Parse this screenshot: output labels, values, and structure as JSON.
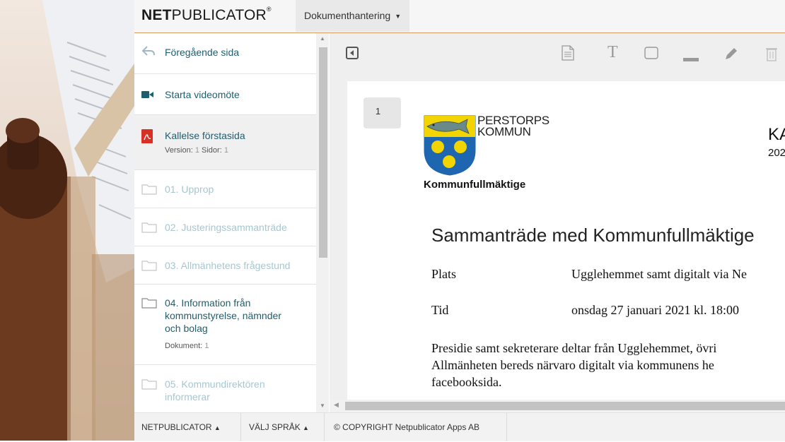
{
  "header": {
    "logo_bold": "NET",
    "logo_rest": "PUBLICATOR",
    "logo_reg": "®",
    "dropdown_label": "Dokumenthantering"
  },
  "sidebar": {
    "items": [
      {
        "label": "Föregående sida",
        "icon": "back-arrow-icon"
      },
      {
        "label": "Starta videomöte",
        "icon": "video-camera-icon"
      },
      {
        "label": "Kallelse förstasida",
        "icon": "pdf-icon",
        "version_label": "Version:",
        "version": "1",
        "pages_label": "Sidor:",
        "pages": "1"
      },
      {
        "label": "01. Upprop",
        "icon": "folder-icon"
      },
      {
        "label": "02. Justeringssammanträde",
        "icon": "folder-icon"
      },
      {
        "label": "03. Allmänhetens frågestund",
        "icon": "folder-icon"
      },
      {
        "label_lines": [
          "04. Information från",
          "kommunstyrelse, nämnder",
          "och bolag"
        ],
        "icon": "folder-icon",
        "docs_label": "Dokument:",
        "docs": "1"
      },
      {
        "label_lines": [
          "05. Kommundirektören",
          "informerar"
        ],
        "icon": "folder-icon"
      }
    ]
  },
  "toolbar": {
    "icons": [
      "collapse-panel-icon",
      "document-icon",
      "text-icon",
      "rectangle-icon",
      "line-icon",
      "pen-icon",
      "trash-icon"
    ]
  },
  "document": {
    "page_number": "1",
    "org_line1": "PERSTORPS",
    "org_line2": "KOMMUN",
    "org_unit": "Kommunfullmäktige",
    "header_right1": "KA",
    "header_right2": "202",
    "title": "Sammanträde med Kommunfullmäktige",
    "rows": [
      {
        "label": "Plats",
        "value": "Ugglehemmet samt digitalt via Ne"
      },
      {
        "label": "Tid",
        "value": "onsdag 27 januari 2021 kl. 18:00"
      }
    ],
    "paragraph_lines": [
      "Presidie samt sekreterare deltar från Ugglehemmet, övri",
      "Allmänheten bereds närvaro digitalt via kommunens he",
      "facebooksida."
    ]
  },
  "footer": {
    "netpublicator": "NETPUBLICATOR",
    "language": "VÄLJ SPRÅK",
    "copyright": "© COPYRIGHT Netpublicator Apps AB"
  },
  "colors": {
    "accent_line": "#d39a63",
    "link_teal": "#1f5e6e",
    "dim_teal": "#a8c6d0",
    "pdf_red": "#d93025"
  }
}
